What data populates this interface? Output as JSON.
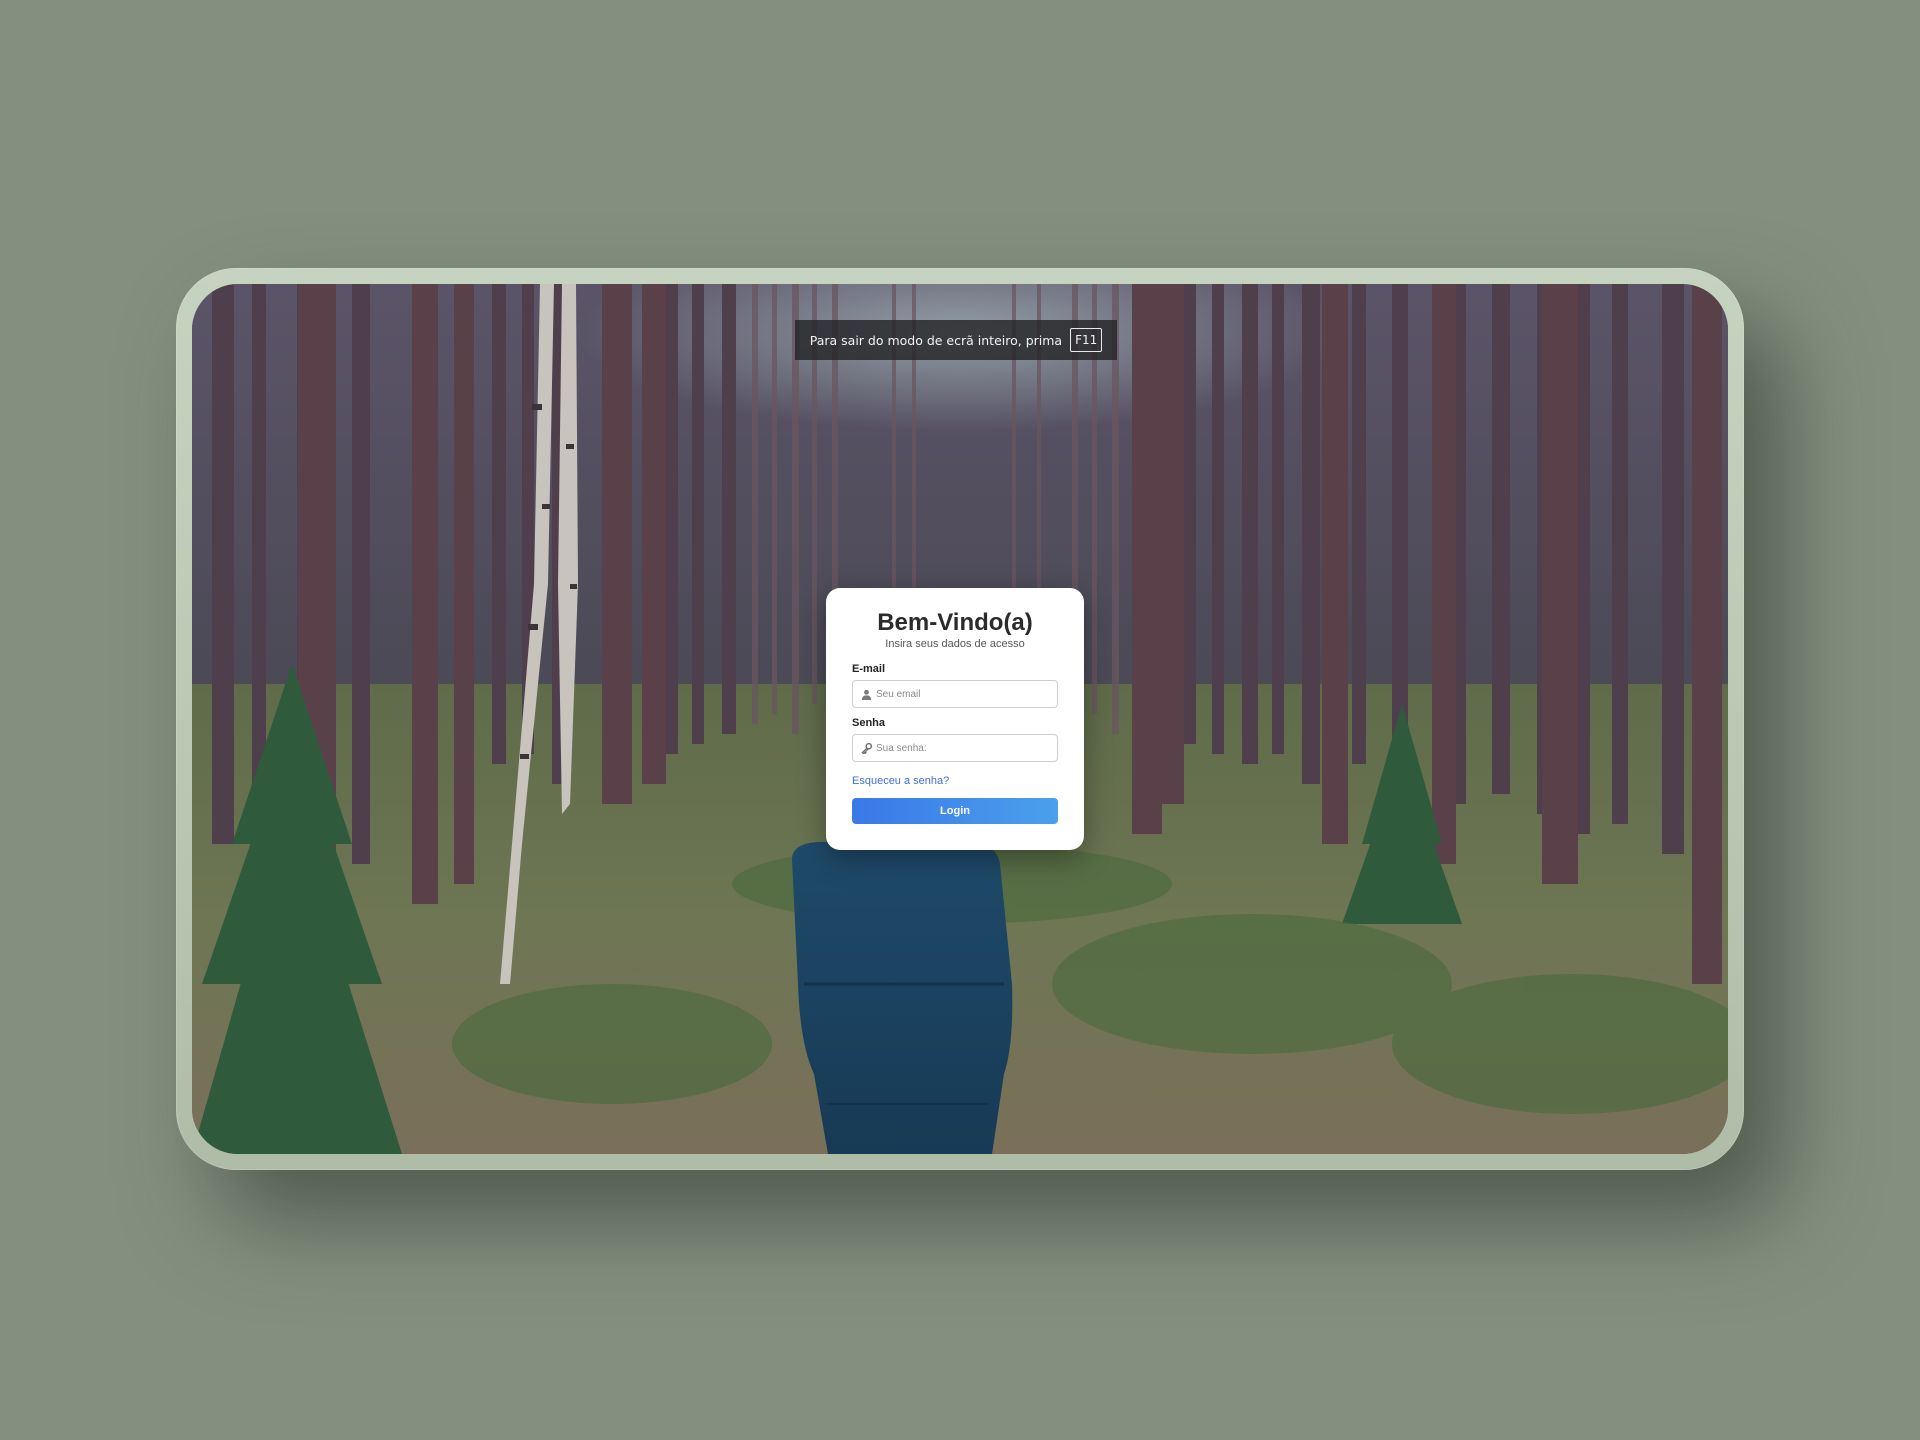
{
  "fullscreen_notice": {
    "text": "Para sair do modo de ecrã inteiro, prima",
    "key": "F11"
  },
  "login": {
    "title": "Bem-Vindo(a)",
    "subtitle": "Insira seus dados de acesso",
    "email_label": "E-mail",
    "email_placeholder": "Seu email",
    "email_icon": "user-icon",
    "password_label": "Senha",
    "password_placeholder": "Sua senha:",
    "password_icon": "key-icon",
    "forgot_link": "Esqueceu a senha?",
    "login_button": "Login"
  },
  "colors": {
    "page_background": "#83907f",
    "frame": "#bccab6",
    "accent": "#3a78e8",
    "link": "#3f6fd8"
  }
}
